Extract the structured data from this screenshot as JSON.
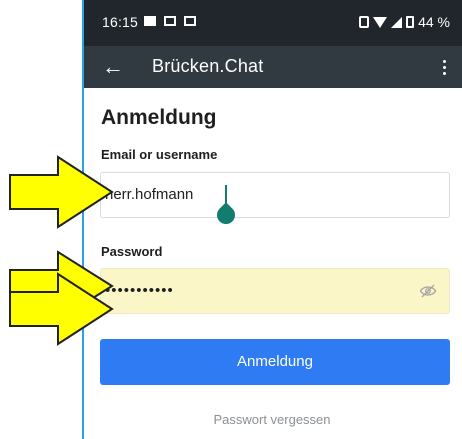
{
  "status_bar": {
    "time": "16:15",
    "battery": "44 %"
  },
  "app_bar": {
    "back_icon": "←",
    "title": "Brücken.Chat"
  },
  "form": {
    "heading": "Anmeldung",
    "email_label": "Email or username",
    "email_value": "herr.hofmann",
    "password_label": "Password",
    "password_value": "•••••••••••",
    "login_label": "Anmeldung",
    "forgot_label": "Passwort vergessen"
  },
  "colors": {
    "status_bar": "#20262b",
    "app_bar": "#303a40",
    "primary_button": "#2f7bf3",
    "autofill_bg": "#fbf6c8",
    "caret": "#117d6e",
    "arrow_fill": "#ffff00"
  }
}
